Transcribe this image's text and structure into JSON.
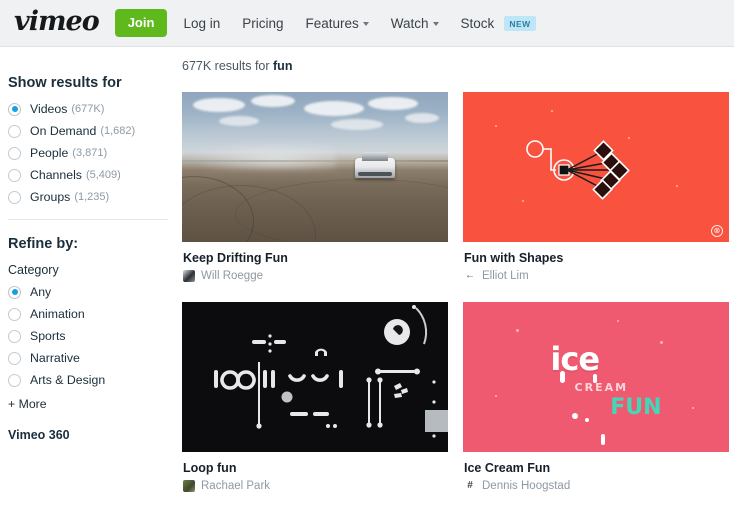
{
  "header": {
    "logo": "vimeo",
    "join_label": "Join",
    "nav": [
      {
        "label": "Log in",
        "caret": false,
        "badge": null
      },
      {
        "label": "Pricing",
        "caret": false,
        "badge": null
      },
      {
        "label": "Features",
        "caret": true,
        "badge": null
      },
      {
        "label": "Watch",
        "caret": true,
        "badge": null
      },
      {
        "label": "Stock",
        "caret": false,
        "badge": "NEW"
      }
    ]
  },
  "sidebar": {
    "show_results_heading": "Show results for",
    "show_results": [
      {
        "label": "Videos",
        "count": "(677K)",
        "selected": true
      },
      {
        "label": "On Demand",
        "count": "(1,682)",
        "selected": false
      },
      {
        "label": "People",
        "count": "(3,871)",
        "selected": false
      },
      {
        "label": "Channels",
        "count": "(5,409)",
        "selected": false
      },
      {
        "label": "Groups",
        "count": "(1,235)",
        "selected": false
      }
    ],
    "refine_heading": "Refine by:",
    "category_label": "Category",
    "categories": [
      {
        "label": "Any",
        "selected": true
      },
      {
        "label": "Animation",
        "selected": false
      },
      {
        "label": "Sports",
        "selected": false
      },
      {
        "label": "Narrative",
        "selected": false
      },
      {
        "label": "Arts & Design",
        "selected": false
      }
    ],
    "more_label": "+ More",
    "vimeo360_label": "Vimeo 360"
  },
  "results": {
    "count_prefix": "677K results for ",
    "query": "fun",
    "cards": [
      {
        "title": "Keep Drifting Fun",
        "author": "Will Roegge",
        "thumb_kind": "photo-drift-car",
        "badge": null
      },
      {
        "title": "Fun with Shapes",
        "author": "Elliot Lim",
        "thumb_kind": "coral-shapes",
        "badge": "cc"
      },
      {
        "title": "Loop fun",
        "author": "Rachael Park",
        "thumb_kind": "dark-loop",
        "badge": null
      },
      {
        "title": "Ice Cream Fun",
        "author": "Dennis Hoogstad",
        "thumb_kind": "ice-cream",
        "badge": null
      }
    ]
  },
  "ice_cream_text": {
    "ice": "ice",
    "cream": "CREAM",
    "fun": "FUN"
  },
  "colors": {
    "join_green": "#5fb91d",
    "radio_blue": "#16a0e0",
    "badge_bg": "#bfe6f7",
    "badge_text": "#2f7fa3",
    "header_bg": "#eff1f2",
    "coral": "#f9533f",
    "pink": "#ef5a70",
    "mint": "#44d6b8"
  }
}
